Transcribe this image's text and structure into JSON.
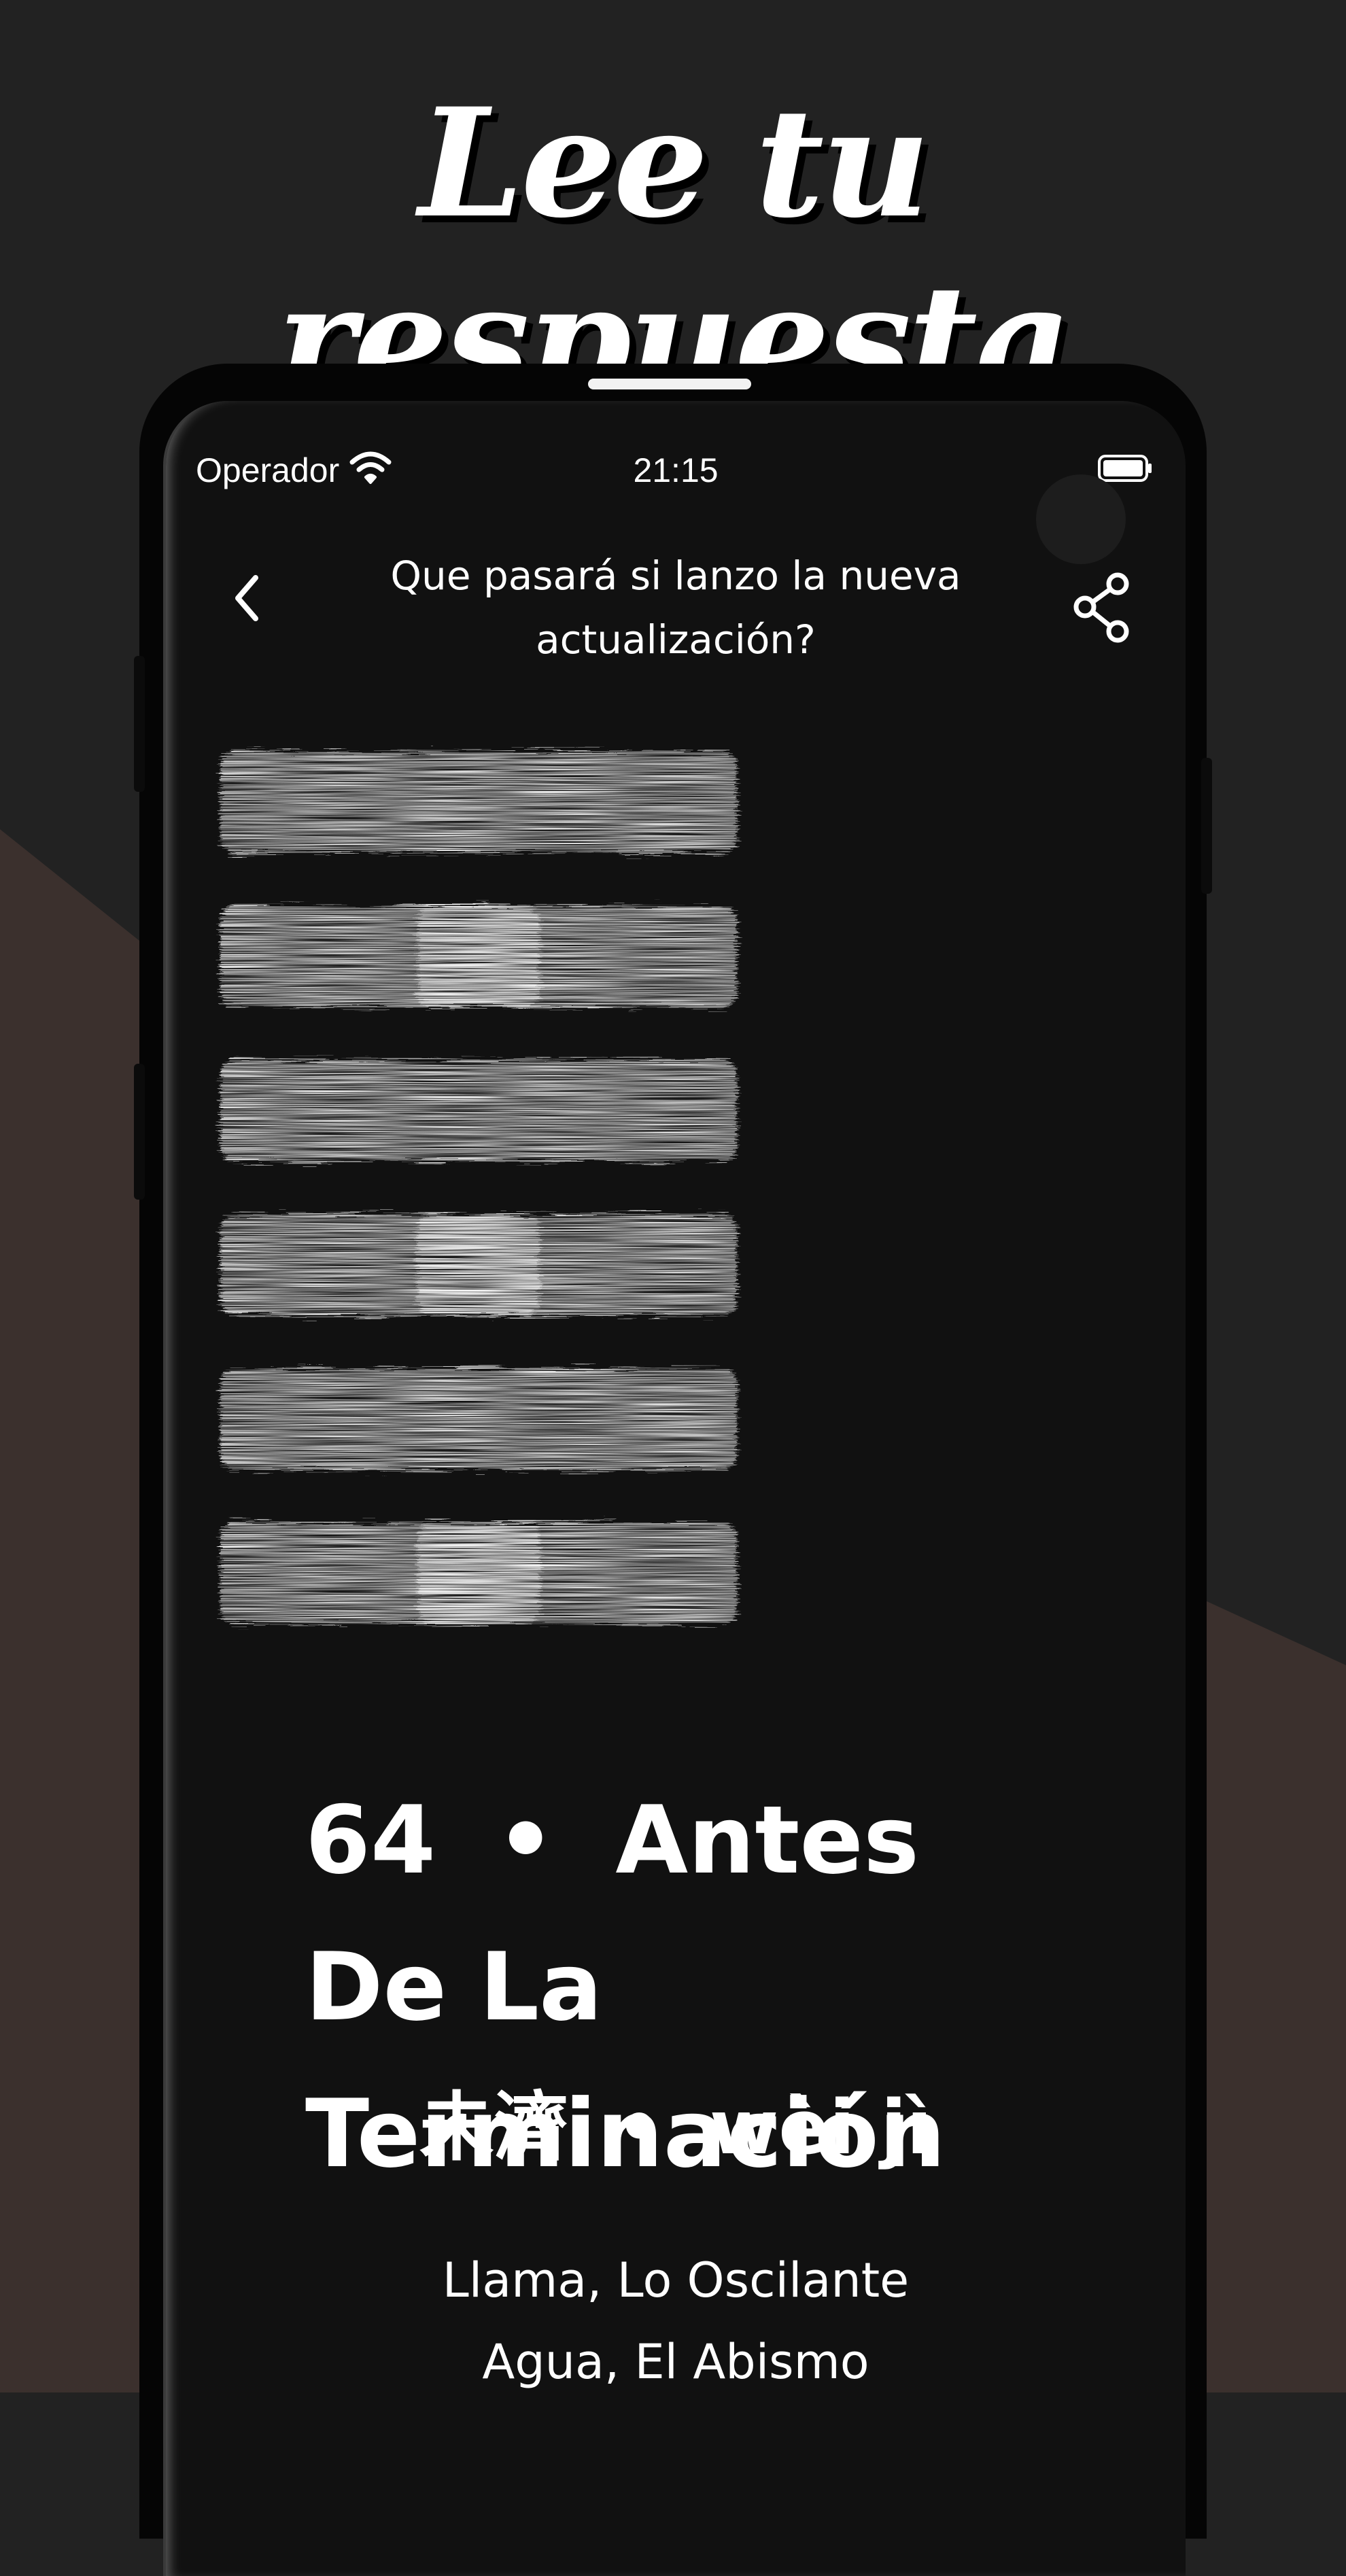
{
  "headline": "Lee tu respuesta",
  "status_bar": {
    "carrier": "Operador",
    "time": "21:15",
    "wifi_icon": "wifi-icon",
    "battery_icon": "battery-icon"
  },
  "header": {
    "question": "Que pasará si lanzo la nueva actualización?",
    "back_icon": "chevron-left-icon",
    "share_icon": "share-icon"
  },
  "hexagram": {
    "lines": [
      "solid",
      "broken",
      "solid",
      "broken",
      "solid",
      "broken"
    ],
    "ink_color": "#f5f5f5"
  },
  "result": {
    "number": "64",
    "separator": "•",
    "title": "Antes De La Terminación",
    "chinese_name": "未濟",
    "pinyin": "wèi jì",
    "upper_trigram": "Llama, Lo Oscilante",
    "lower_trigram": "Agua, El Abismo"
  },
  "colors": {
    "background": "#222222",
    "wedge": "#3b302d",
    "screen": "#111111",
    "text": "#ffffff"
  }
}
